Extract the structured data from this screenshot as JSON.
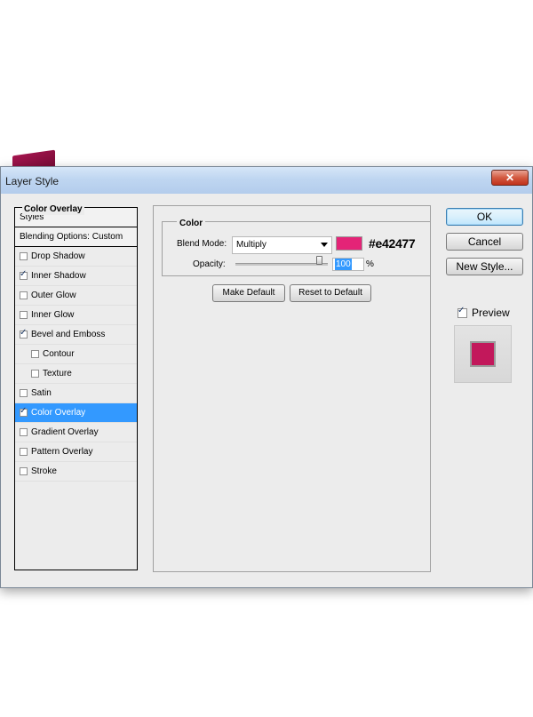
{
  "window": {
    "title": "Layer Style",
    "close_glyph": "✕"
  },
  "style_list": {
    "header": "Styles",
    "blending": "Blending Options: Custom",
    "items": [
      {
        "label": "Drop Shadow",
        "checked": false,
        "sub": false,
        "selected": false
      },
      {
        "label": "Inner Shadow",
        "checked": true,
        "sub": false,
        "selected": false
      },
      {
        "label": "Outer Glow",
        "checked": false,
        "sub": false,
        "selected": false
      },
      {
        "label": "Inner Glow",
        "checked": false,
        "sub": false,
        "selected": false
      },
      {
        "label": "Bevel and Emboss",
        "checked": true,
        "sub": false,
        "selected": false
      },
      {
        "label": "Contour",
        "checked": false,
        "sub": true,
        "selected": false
      },
      {
        "label": "Texture",
        "checked": false,
        "sub": true,
        "selected": false
      },
      {
        "label": "Satin",
        "checked": false,
        "sub": false,
        "selected": false
      },
      {
        "label": "Color Overlay",
        "checked": true,
        "sub": false,
        "selected": true
      },
      {
        "label": "Gradient Overlay",
        "checked": false,
        "sub": false,
        "selected": false
      },
      {
        "label": "Pattern Overlay",
        "checked": false,
        "sub": false,
        "selected": false
      },
      {
        "label": "Stroke",
        "checked": false,
        "sub": false,
        "selected": false
      }
    ]
  },
  "panel": {
    "title": "Color Overlay",
    "color_group": "Color",
    "blend_mode_label": "Blend Mode:",
    "blend_mode_value": "Multiply",
    "swatch_color": "#e42477",
    "hex_text": "#e42477",
    "opacity_label": "Opacity:",
    "opacity_value": "100",
    "opacity_unit": "%",
    "opacity_fraction": 1.0,
    "make_default": "Make Default",
    "reset_default": "Reset to Default"
  },
  "buttons": {
    "ok": "OK",
    "cancel": "Cancel",
    "new_style": "New Style..."
  },
  "preview": {
    "label": "Preview",
    "checked": true,
    "swatch_color": "#c2185b"
  },
  "colors": {
    "accent_selection": "#3399ff",
    "artwork_magenta": "#a5154f"
  }
}
